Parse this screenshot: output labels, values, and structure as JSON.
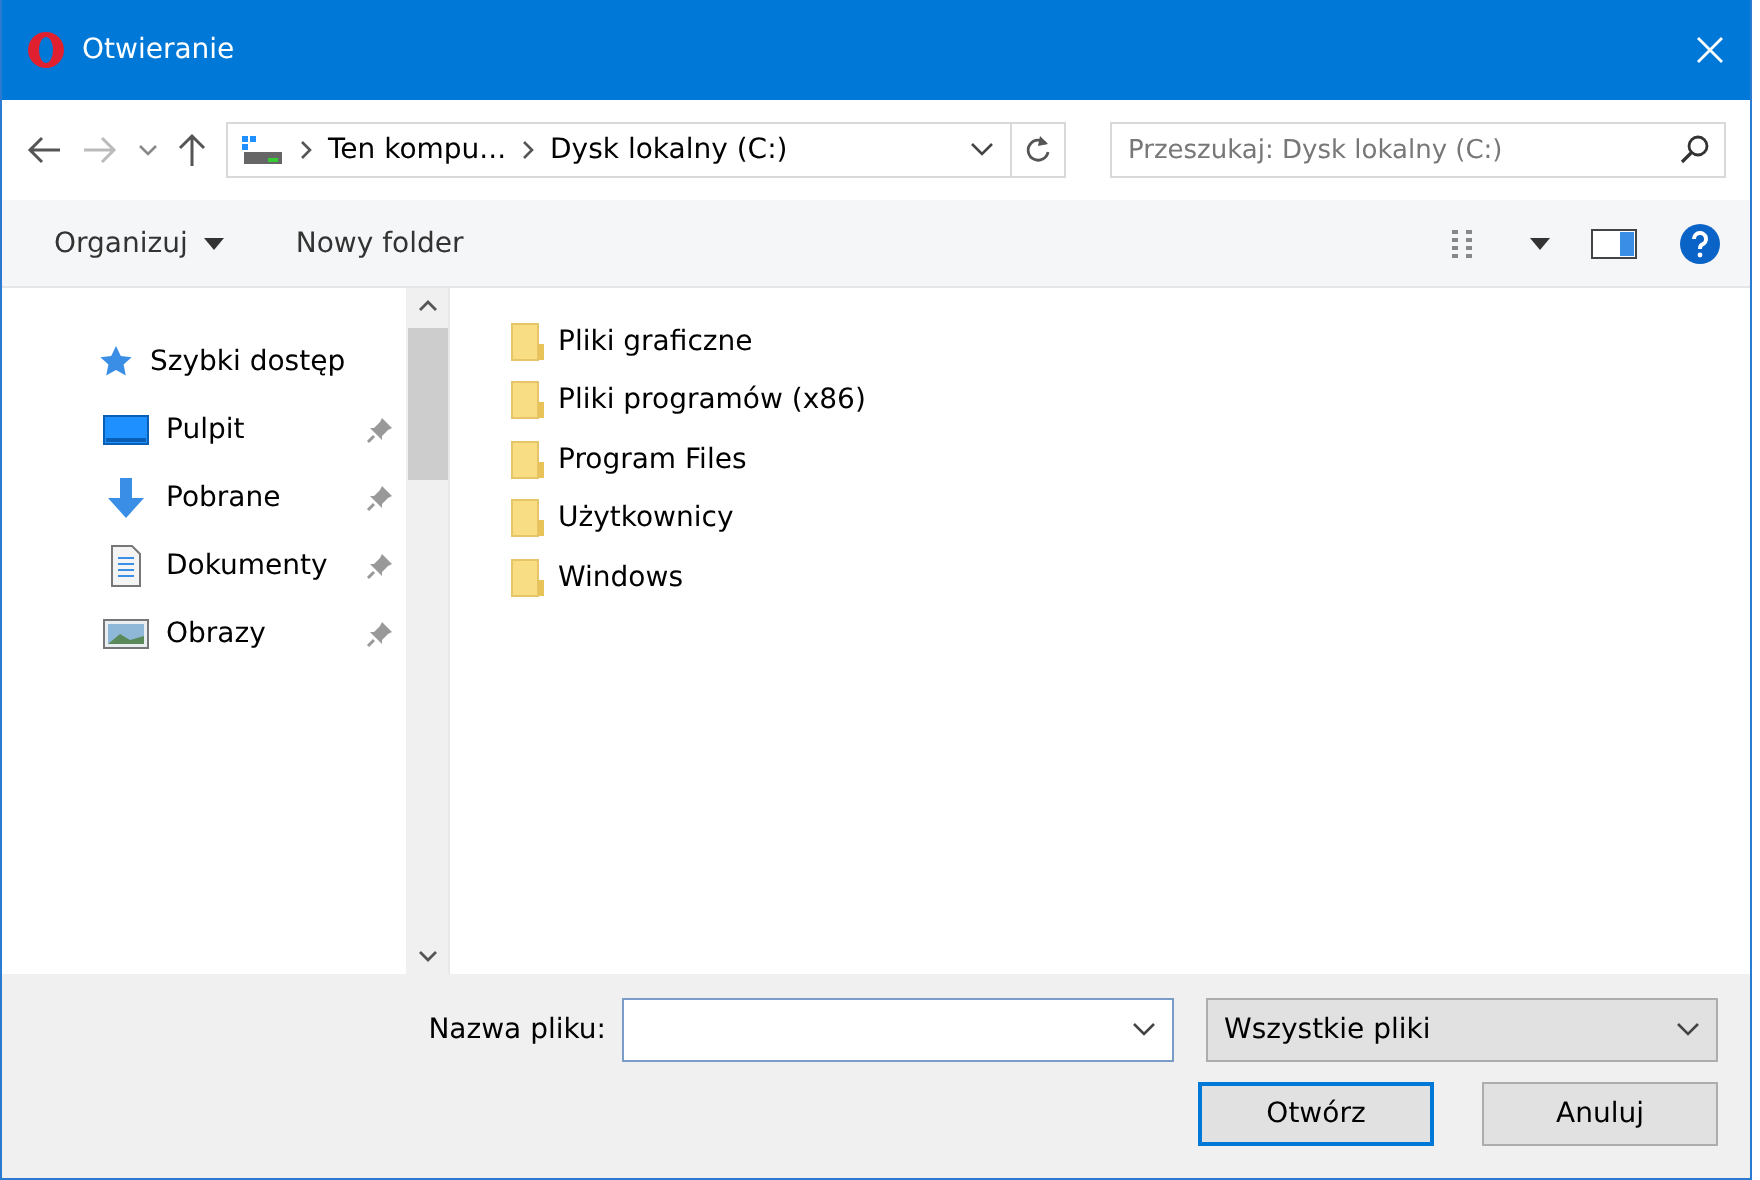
{
  "window": {
    "title": "Otwieranie"
  },
  "address_bar": {
    "crumbs": [
      "Ten kompu...",
      "Dysk lokalny (C:)"
    ]
  },
  "search": {
    "placeholder": "Przeszukaj: Dysk lokalny (C:)"
  },
  "toolbar": {
    "buttons": [
      {
        "label": "Organizuj",
        "kind": "menu"
      },
      {
        "label": "Nowy folder",
        "kind": "plain"
      }
    ]
  },
  "sidebar": {
    "items": [
      {
        "label": "Szybki dostęp",
        "kind": "quick",
        "pinned": false
      },
      {
        "label": "Pulpit",
        "kind": "desktop",
        "pinned": true
      },
      {
        "label": "Pobrane",
        "kind": "download",
        "pinned": true
      },
      {
        "label": "Dokumenty",
        "kind": "documents",
        "pinned": true
      },
      {
        "label": "Obrazy",
        "kind": "pictures",
        "pinned": true
      }
    ]
  },
  "files": [
    {
      "name": "Pliki graficzne"
    },
    {
      "name": "Pliki programów (x86)"
    },
    {
      "name": "Program Files"
    },
    {
      "name": "Użytkownicy"
    },
    {
      "name": "Windows"
    }
  ],
  "filename": {
    "label": "Nazwa pliku:"
  },
  "filter": {
    "value": "Wszystkie pliki"
  },
  "buttons": [
    {
      "label": "Otwórz",
      "default": true
    },
    {
      "label": "Anuluj",
      "default": false
    }
  ]
}
